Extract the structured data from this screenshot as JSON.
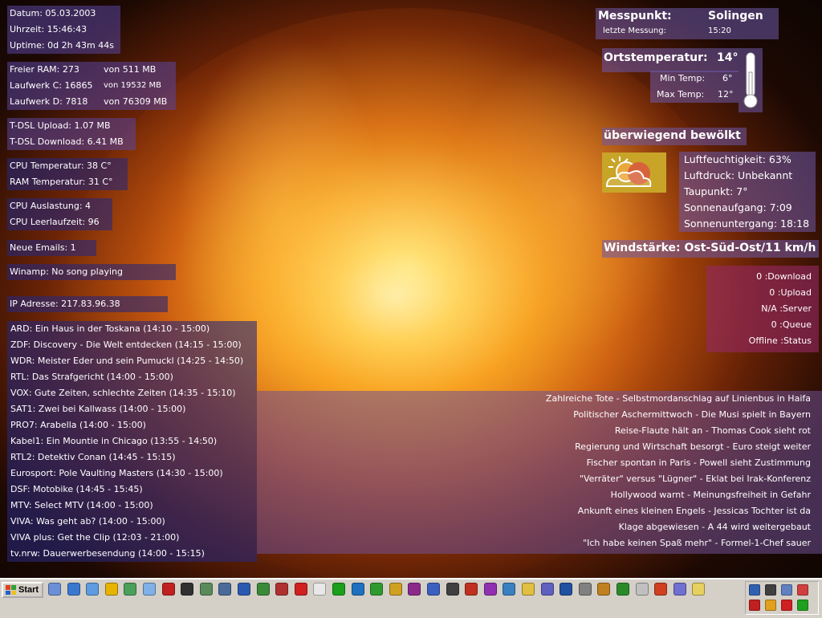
{
  "system": {
    "date_label": "Datum:",
    "date": "05.03.2003",
    "time_label": "Uhrzeit:",
    "time": "15:46:43",
    "uptime_label": "Uptime:",
    "uptime": "0d 2h 43m 44s"
  },
  "memory": {
    "ram": "Freier RAM: 273",
    "ram_total": "von 511 MB",
    "drive_c": "Laufwerk C: 16865",
    "drive_c_total": "von 19532 MB",
    "drive_d": "Laufwerk D: 7818",
    "drive_d_total": "von 76309 MB"
  },
  "network": {
    "upload": "T-DSL Upload: 1.07 MB",
    "download": "T-DSL Download: 6.41 MB"
  },
  "temps": {
    "cpu": "CPU Temperatur: 38 C°",
    "ram": "RAM Temperatur: 31 C°"
  },
  "cpu": {
    "load": "CPU Auslastung: 4",
    "idle": "CPU Leerlaufzeit: 96"
  },
  "emails": "Neue Emails: 1",
  "winamp": "Winamp: No song playing",
  "ip": "IP Adresse: 217.83.96.38",
  "tv": [
    "ARD: Ein Haus in der Toskana (14:10 - 15:00)",
    "ZDF: Discovery - Die Welt entdecken (14:15 - 15:00)",
    "WDR: Meister Eder und sein Pumuckl (14:25 - 14:50)",
    "RTL: Das Strafgericht (14:00 - 15:00)",
    "VOX: Gute Zeiten, schlechte Zeiten (14:35 - 15:10)",
    "SAT1: Zwei bei Kallwass (14:00 - 15:00)",
    "PRO7: Arabella (14:00 - 15:00)",
    "Kabel1: Ein Mountie in Chicago (13:55 - 14:50)",
    "RTL2: Detektiv Conan (14:45 - 15:15)",
    "Eurosport: Pole Vaulting Masters (14:30 - 15:00)",
    "DSF: Motobike (14:45 - 15:45)",
    "MTV: Select MTV (14:00 - 15:00)",
    "VIVA: Was geht ab? (14:00 - 15:00)",
    "VIVA plus: Get the Clip (12:03 - 21:00)",
    "tv.nrw: Dauerwerbesendung (14:00 - 15:15)"
  ],
  "weather": {
    "station_label": "Messpunkt:",
    "station": "Solingen",
    "last_label": "letzte Messung:",
    "last_time": "15:20",
    "temp_label": "Ortstemperatur:",
    "temp": "14°",
    "min_label": "Min Temp:",
    "min": "6°",
    "max_label": "Max Temp:",
    "max": "12°",
    "condition": "überwiegend bewölkt",
    "humidity": "Luftfeuchtigkeit: 63%",
    "pressure": "Luftdruck: Unbekannt",
    "dewpoint": "Taupunkt: 7°",
    "sunrise": "Sonnenaufgang: 7:09",
    "sunset": "Sonnenuntergang: 18:18",
    "wind": "Windstärke: Ost-Süd-Ost/11 km/h"
  },
  "p2p": [
    "0 :Download",
    "0 :Upload",
    "N/A :Server",
    "0 :Queue",
    "Offline :Status"
  ],
  "news": [
    "Zahlreiche Tote - Selbstmordanschlag auf Linienbus in Haifa",
    "Politischer Aschermittwoch - Die Musi spielt in Bayern",
    "Reise-Flaute hält an - Thomas Cook sieht rot",
    "Regierung und Wirtschaft besorgt - Euro steigt weiter",
    "Fischer spontan in Paris - Powell sieht Zustimmung",
    "\"Verräter\" versus \"Lügner\" - Eklat bei Irak-Konferenz",
    "Hollywood warnt - Meinungsfreiheit in Gefahr",
    "Ankunft eines kleinen Engels - Jessicas Tochter ist da",
    "Klage abgewiesen - A 44 wird weitergebaut",
    "\"Ich habe keinen Spaß mehr\" - Formel-1-Chef sauer"
  ],
  "taskbar": {
    "start_label": "Start",
    "quicklaunch_colors": [
      "#6b8fd6",
      "#3a78d0",
      "#5e9be0",
      "#e6b400",
      "#4aa05a",
      "#7fb0e8",
      "#c02020",
      "#303030",
      "#5a8a5a",
      "#4a6a9a",
      "#2a5ab0",
      "#3a8a3a",
      "#b03030",
      "#d02020",
      "#e8e8e8",
      "#1aa01a",
      "#2070c0",
      "#2e9a2e",
      "#d0a020",
      "#8a2a8a",
      "#3a60c0",
      "#404040",
      "#c03020",
      "#9030b0",
      "#3a80c0",
      "#e0c040",
      "#6060c0",
      "#2050a0",
      "#808080",
      "#c08020",
      "#2a8a2a",
      "#c0c0c0",
      "#d04020",
      "#7070d0",
      "#e8d060"
    ],
    "tray_colors": [
      "#3060b0",
      "#404040",
      "#6080c0",
      "#d04040",
      "#c02020",
      "#e0a020",
      "#d02020",
      "#20a020"
    ]
  },
  "colors": {
    "panel": "#5a46a0",
    "panel_dark": "#282878",
    "panel_pink": "#962864"
  }
}
